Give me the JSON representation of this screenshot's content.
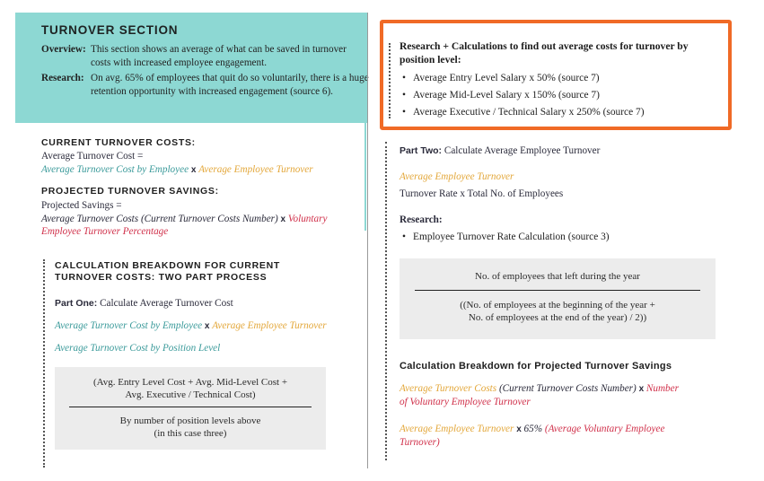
{
  "colors": {
    "teal_panel": "#8dd8d3",
    "teal_text": "#3a9a9a",
    "gold_text": "#e3a73a",
    "red_text": "#d0304a",
    "orange_highlight": "#f06a26",
    "formula_box": "#ececec"
  },
  "turnover_section": {
    "title": "TURNOVER SECTION",
    "overview_label": "Overview:",
    "overview_text": "This section shows an average of what can be saved in turnover costs with increased employee engagement.",
    "research_label": "Research:",
    "research_text": "On avg. 65% of employees that quit do so voluntarily, there is a huge retention opportunity with increased engagement (source 6)."
  },
  "current_costs": {
    "heading": "CURRENT TURNOVER COSTS:",
    "label": "Average Turnover Cost =",
    "term1": "Average Turnover Cost by Employee",
    "op": "x",
    "term2": "Average Employee Turnover"
  },
  "projected_savings": {
    "heading": "PROJECTED TURNOVER SAVINGS:",
    "label": "Projected Savings =",
    "term1": "Average Turnover Costs (Current Turnover Costs Number)",
    "op": "x",
    "term2_line1": "Voluntary",
    "term2_line2": "Employee Turnover Percentage"
  },
  "breakdown_current": {
    "heading_line1": "CALCULATION BREAKDOWN FOR CURRENT",
    "heading_line2": "TURNOVER COSTS: TWO PART PROCESS",
    "part_one_label": "Part One:",
    "part_one_text": "Calculate Average Turnover Cost",
    "formula_term1": "Average Turnover Cost by Employee",
    "formula_op": "x",
    "formula_term2": "Average Employee Turnover",
    "position_level_label": "Average Turnover Cost by Position Level",
    "fraction": {
      "numerator_line1": "(Avg. Entry Level Cost + Avg. Mid-Level Cost +",
      "numerator_line2": "Avg. Executive / Technical Cost)",
      "denominator_line1": "By number of position levels above",
      "denominator_line2": "(in this case three)"
    }
  },
  "research_box": {
    "title": "Research + Calculations to find out average costs for turnover by position level:",
    "bullet": "•",
    "items": [
      "Average Entry Level Salary x 50% (source 7)",
      "Average Mid-Level Salary x 150%  (source 7)",
      "Average Executive / Technical Salary x 250% (source 7)"
    ]
  },
  "part_two": {
    "label": "Part Two:",
    "text": "Calculate Average Employee Turnover",
    "term": "Average Employee Turnover",
    "formula": "Turnover Rate x Total No. of Employees",
    "research_label": "Research:",
    "research_items": [
      "Employee Turnover Rate Calculation (source 3)"
    ],
    "fraction": {
      "numerator": "No. of employees that left during the year",
      "denominator_line1": "((No. of employees at the beginning of the year +",
      "denominator_line2": "No. of employees at the end of the year) / 2))"
    }
  },
  "breakdown_projected": {
    "heading": "Calculation Breakdown for Projected Turnover Savings",
    "f1_term1": "Average Turnover Costs",
    "f1_term1b": "(Current Turnover Costs Number)",
    "f1_op": "x",
    "f1_term2_line1": "Number",
    "f1_term2_line2": "of Voluntary Employee Turnover",
    "f2_term1": "Average Employee Turnover",
    "f2_op": "x",
    "f2_pct": "65%",
    "f2_term2_line1": "(Average Voluntary Employee",
    "f2_term2_line2": "Turnover)"
  }
}
